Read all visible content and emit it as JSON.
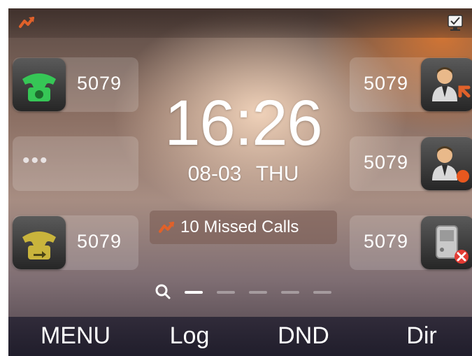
{
  "statusbar": {
    "left_icon": "missed-call-arrow-icon",
    "right_icon": "screen-check-icon"
  },
  "lines_left": [
    {
      "number": "5079",
      "icon": "green-phone-icon"
    },
    {
      "label": "•••"
    },
    {
      "number": "5079",
      "icon": "yellow-forward-phone-icon"
    }
  ],
  "lines_right": [
    {
      "number": "5079",
      "icon": "contact-arrow-icon"
    },
    {
      "number": "5079",
      "icon": "contact-busy-icon"
    },
    {
      "number": "5079",
      "icon": "device-error-icon"
    }
  ],
  "clock": {
    "time": "16:26",
    "date": "08-03",
    "weekday": "THU"
  },
  "missed": {
    "text": "10 Missed Calls",
    "icon": "missed-call-arrow-icon"
  },
  "pager": {
    "pages": 5,
    "active": 0
  },
  "softkeys": [
    {
      "label": "MENU"
    },
    {
      "label": "Log"
    },
    {
      "label": "DND"
    },
    {
      "label": "Dir"
    }
  ],
  "colors": {
    "accent_orange": "#d9622a",
    "phone_green": "#2fbf4a",
    "phone_yellow": "#c7b13a",
    "error_red": "#e33b33"
  }
}
